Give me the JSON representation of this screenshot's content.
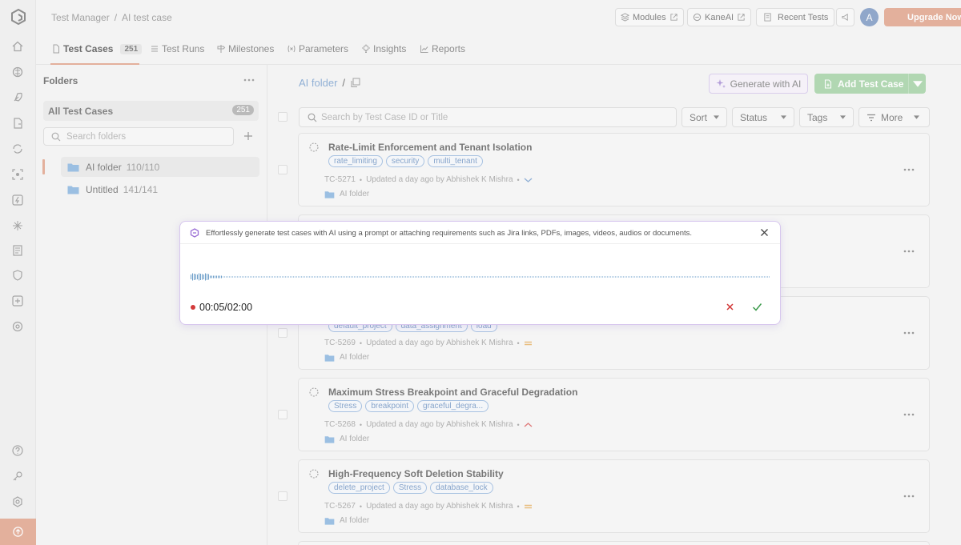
{
  "breadcrumb": {
    "root": "Test Manager",
    "separator": "/",
    "current": "AI test case"
  },
  "topbar": {
    "modules": "Modules",
    "kaneai": "KaneAI",
    "recent_tests": "Recent Tests",
    "avatar_initial": "A",
    "upgrade": "Upgrade Now"
  },
  "tabs": [
    {
      "label": "Test Cases",
      "count": "251",
      "active": true
    },
    {
      "label": "Test Runs"
    },
    {
      "label": "Milestones"
    },
    {
      "label": "Parameters"
    },
    {
      "label": "Insights"
    },
    {
      "label": "Reports"
    }
  ],
  "folders": {
    "title": "Folders",
    "all_label": "All Test Cases",
    "all_count": "251",
    "search_placeholder": "Search folders",
    "items": [
      {
        "name": "AI folder",
        "count": "110/110",
        "active": true
      },
      {
        "name": "Untitled",
        "count": "141/141"
      }
    ]
  },
  "main": {
    "folder_crumb": "AI folder",
    "crumb_slash": "/",
    "generate_ai": "Generate with AI",
    "add_case": "Add Test Case",
    "search_placeholder": "Search by Test Case ID or Title",
    "filters": {
      "sort": "Sort",
      "status": "Status",
      "tags": "Tags",
      "more": "More"
    }
  },
  "cases": [
    {
      "title": "Rate-Limit Enforcement and Tenant Isolation",
      "tags": [
        "rate_limiting",
        "security",
        "multi_tenant"
      ],
      "id": "TC-5271",
      "updated": "Updated a day ago by Abhishek K Mishra",
      "priority": "low",
      "folder": "AI folder"
    },
    {
      "title": "",
      "tags": [],
      "id": "",
      "updated": "",
      "priority": "",
      "folder": ""
    },
    {
      "title": "",
      "tags": [
        "default_project",
        "data_assignment",
        "load"
      ],
      "id": "TC-5269",
      "updated": "Updated a day ago by Abhishek K Mishra",
      "priority": "medium",
      "folder": "AI folder"
    },
    {
      "title": "Maximum Stress Breakpoint and Graceful Degradation",
      "tags": [
        "Stress",
        "breakpoint",
        "graceful_degra..."
      ],
      "id": "TC-5268",
      "updated": "Updated a day ago by Abhishek K Mishra",
      "priority": "high",
      "folder": "AI folder"
    },
    {
      "title": "High-Frequency Soft Deletion Stability",
      "tags": [
        "delete_project",
        "Stress",
        "database_lock"
      ],
      "id": "TC-5267",
      "updated": "Updated a day ago by Abhishek K Mishra",
      "priority": "medium",
      "folder": "AI folder"
    }
  ],
  "modal": {
    "hint": "Effortlessly generate test cases with AI using a prompt or attaching requirements such as Jira links, PDFs, images, videos, audios or documents.",
    "timer": "00:05/02:00"
  },
  "colors": {
    "accent": "#d98a6c",
    "link": "#5b8bc4",
    "ai_purple": "#8f6ec9",
    "success": "#8cc78e",
    "record": "#d33a3a"
  },
  "rail_icons": [
    "home-icon",
    "brain-icon",
    "rocket-icon",
    "test-file-icon",
    "sync-icon",
    "eye-scan-icon",
    "lightning-box-icon",
    "sparkle-icon",
    "document-list-icon",
    "shield-icon",
    "plus-box-icon",
    "settings-icon",
    "help-icon",
    "key-icon",
    "integration-icon",
    "upgrade-arrow-icon"
  ]
}
